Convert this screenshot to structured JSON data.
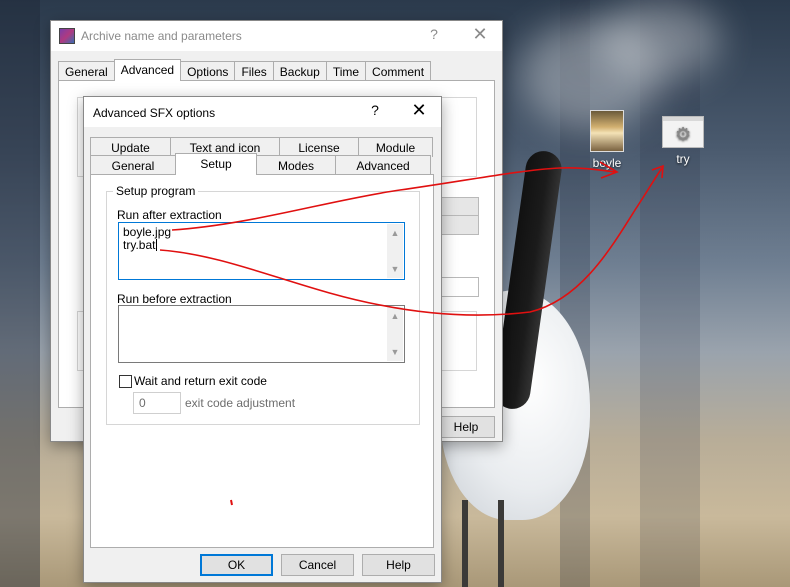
{
  "desktop": {
    "icons": [
      {
        "name": "boyle",
        "label": "boyle",
        "icon": "image-thumbnail-icon"
      },
      {
        "name": "try",
        "label": "try",
        "icon": "batch-file-gears-icon"
      }
    ]
  },
  "archive_window": {
    "title": "Archive name and parameters",
    "help": "?",
    "close": "✕",
    "tabs": [
      {
        "label": "General"
      },
      {
        "label": "Advanced",
        "active": true
      },
      {
        "label": "Options"
      },
      {
        "label": "Files"
      },
      {
        "label": "Backup"
      },
      {
        "label": "Time"
      },
      {
        "label": "Comment"
      }
    ],
    "help_button": "Help"
  },
  "sfx_dialog": {
    "title": "Advanced SFX options",
    "help": "?",
    "close": "✕",
    "tabs_back_row": [
      {
        "label": "Update"
      },
      {
        "label": "Text and icon"
      },
      {
        "label": "License"
      },
      {
        "label": "Module"
      }
    ],
    "tabs_front_row": [
      {
        "label": "General"
      },
      {
        "label": "Setup",
        "active": true
      },
      {
        "label": "Modes"
      },
      {
        "label": "Advanced"
      }
    ],
    "setup_group_title": "Setup program",
    "run_after": {
      "label": "Run after extraction",
      "lines": [
        "boyle.jpg",
        "try.bat"
      ]
    },
    "run_before": {
      "label": "Run before extraction",
      "lines": []
    },
    "wait_checkbox": {
      "label": "Wait and return exit code",
      "checked": false
    },
    "exit_code": {
      "value": "0",
      "label": "exit code adjustment"
    },
    "buttons": {
      "ok": "OK",
      "cancel": "Cancel",
      "help": "Help"
    }
  },
  "colors": {
    "accent": "#0078d7",
    "annotation_red": "#e01010",
    "dialog_bg": "#f0f0f0"
  }
}
